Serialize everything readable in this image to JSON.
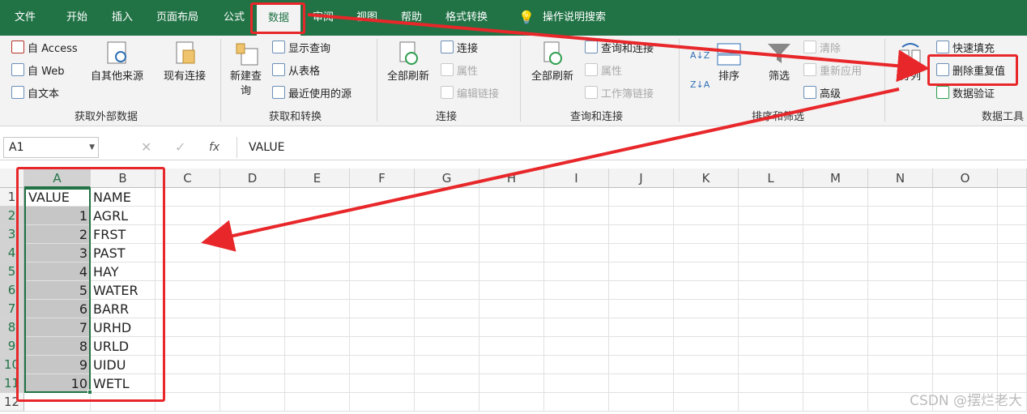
{
  "tabs": [
    "文件",
    "开始",
    "插入",
    "页面布局",
    "公式",
    "数据",
    "审阅",
    "视图",
    "帮助",
    "格式转换",
    "操作说明搜索"
  ],
  "active_tab": "数据",
  "ribbon": {
    "get_external": {
      "access": "自 Access",
      "web": "自 Web",
      "text": "自文本",
      "other": "自其他来源",
      "existing": "现有连接",
      "group": "获取外部数据"
    },
    "transform": {
      "new_query": "新建查",
      "new_query2": "询",
      "show": "显示查询",
      "from_table": "从表格",
      "recent": "最近使用的源",
      "group": "获取和转换"
    },
    "connections": {
      "refresh": "全部刷新",
      "conn": "连接",
      "props": "属性",
      "edit_links": "编辑链接",
      "group": "连接"
    },
    "queries": {
      "refresh": "全部刷新",
      "query_conn": "查询和连接",
      "props": "属性",
      "workbook_links": "工作簿链接",
      "group": "查询和连接"
    },
    "sort": {
      "sort": "排序",
      "filter": "筛选",
      "clear": "清除",
      "reapply": "重新应用",
      "advanced": "高级",
      "group": "排序和筛选"
    },
    "tools": {
      "split": "分列",
      "flash_fill": "快速填充",
      "remove_dup": "删除重复值",
      "validation": "数据验证",
      "group": "数据工具"
    }
  },
  "formula_bar": {
    "name_box": "A1",
    "fx": "fx",
    "value": "VALUE"
  },
  "columns": [
    "A",
    "B",
    "C",
    "D",
    "E",
    "F",
    "G",
    "H",
    "I",
    "J",
    "K",
    "L",
    "M",
    "N",
    "O"
  ],
  "rows": [
    "1",
    "2",
    "3",
    "4",
    "5",
    "6",
    "7",
    "8",
    "9",
    "10",
    "11",
    "12"
  ],
  "cells": [
    [
      "VALUE",
      "NAME"
    ],
    [
      "1",
      "AGRL"
    ],
    [
      "2",
      "FRST"
    ],
    [
      "3",
      "PAST"
    ],
    [
      "4",
      "HAY"
    ],
    [
      "5",
      "WATER"
    ],
    [
      "6",
      "BARR"
    ],
    [
      "7",
      "URHD"
    ],
    [
      "8",
      "URLD"
    ],
    [
      "9",
      "UIDU"
    ],
    [
      "10",
      "WETL"
    ]
  ],
  "watermark": "CSDN @摆烂老大",
  "colors": {
    "accent": "#217346",
    "annotation": "#e8272a"
  }
}
